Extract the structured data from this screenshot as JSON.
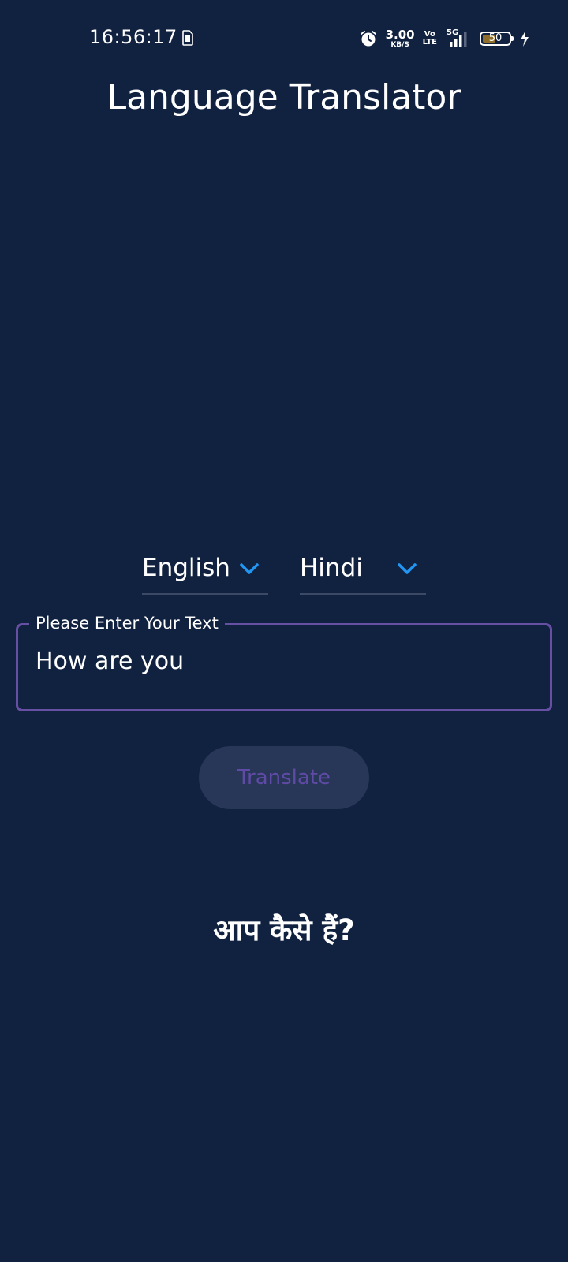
{
  "status_bar": {
    "time": "16:56:17",
    "network_speed_value": "3.00",
    "network_speed_unit": "KB/S",
    "volte_top": "Vo",
    "volte_bottom": "LTE",
    "network_type": "5G",
    "battery_level": "50",
    "battery_fraction": 0.5
  },
  "app": {
    "title": "Language Translator"
  },
  "language_selector": {
    "source": "English",
    "target": "Hindi",
    "arrow_color": "#2196f3"
  },
  "input": {
    "label": "Please Enter Your Text",
    "value": "How are you",
    "border_color": "#6750a4"
  },
  "translate_button": {
    "label": "Translate"
  },
  "result": {
    "text": "आप कैसे हैं?"
  }
}
